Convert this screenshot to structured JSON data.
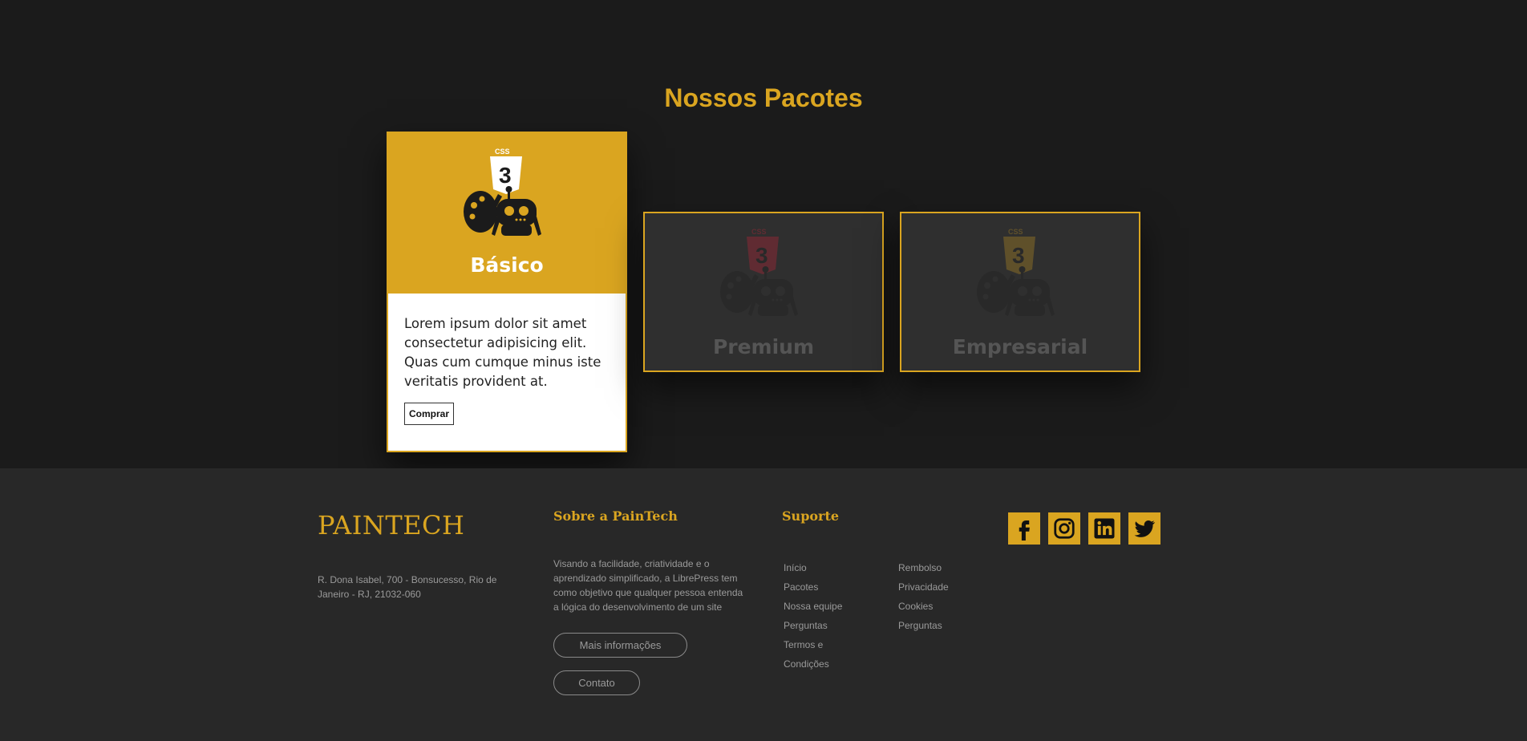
{
  "section": {
    "title": "Nossos Pacotes"
  },
  "cards": [
    {
      "name": "Básico",
      "description": "Lorem ipsum dolor sit amet consectetur adipisicing elit. Quas cum cumque minus iste veritatis provident at.",
      "button": "Comprar",
      "shield_color": "#ffffff"
    },
    {
      "name": "Premium",
      "shield_color": "#e0243a"
    },
    {
      "name": "Empresarial",
      "shield_color": "#daa520"
    }
  ],
  "icons": {
    "package_icon": "css3-palette-robot-icon"
  },
  "footer": {
    "brand": "PAINTECH",
    "address": "R. Dona Isabel, 700 - Bonsucesso, Rio de Janeiro - RJ, 21032-060",
    "about": {
      "title": "Sobre a PainTech",
      "text": "Visando a facilidade, criatividade e o aprendizado simplificado, a LibrePress tem como objetivo que qualquer pessoa entenda a lógica do desenvolvimento de um site",
      "more_button": "Mais informações",
      "contact_button": "Contato"
    },
    "support": {
      "title": "Suporte",
      "links_col1": [
        "Início",
        "Pacotes",
        "Nossa equipe",
        "Perguntas",
        "Termos e",
        "Condições"
      ],
      "links_col2": [
        "Rembolso",
        "Privacidade",
        "Cookies",
        "Perguntas"
      ]
    },
    "socials": [
      "facebook-icon",
      "instagram-icon",
      "linkedin-icon",
      "twitter-icon"
    ]
  },
  "colors": {
    "accent": "#daa520",
    "background": "#1b1b1b",
    "footer_bg": "#282828",
    "card_dim_bg": "#2f2f2f"
  }
}
